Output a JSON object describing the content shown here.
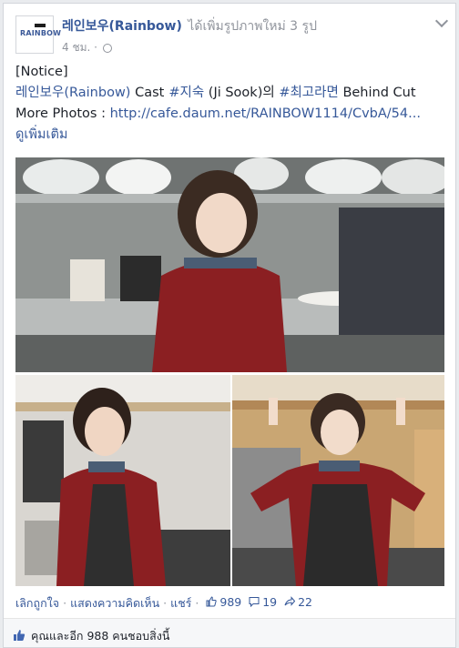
{
  "post": {
    "page_name": "레인보우(Rainbow)",
    "action_text": "ได้เพิ่มรูปภาพใหม่ 3 รูป",
    "time": "4 ชม.",
    "time_sep": "·",
    "logo_text": "RAINBOW",
    "body": {
      "notice": "[Notice]",
      "line2_a": "레인보우(Rainbow)",
      "line2_b": "Cast",
      "line2_c": "#지숙",
      "line2_d": "(Ji Sook)의",
      "line2_e": "#최고라면",
      "line2_f": "Behind Cut",
      "line3_a": "More Photos :",
      "line3_link": "http://cafe.daum.net/RAINBOW1114/CvbA/54...",
      "see_more": "ดูเพิ่มเติม"
    }
  },
  "actions": {
    "unlike": "เลิกถูกใจ",
    "comment": "แสดงความคิดเห็น",
    "share": "แชร์",
    "sep": "·",
    "likes": "989",
    "comments": "19",
    "shares": "22"
  },
  "footer": {
    "text": "คุณและอีก 988 คนชอบสิ่งนี้"
  },
  "colors": {
    "link": "#365899",
    "muted": "#90949c",
    "sweater": "#8b1f22"
  }
}
